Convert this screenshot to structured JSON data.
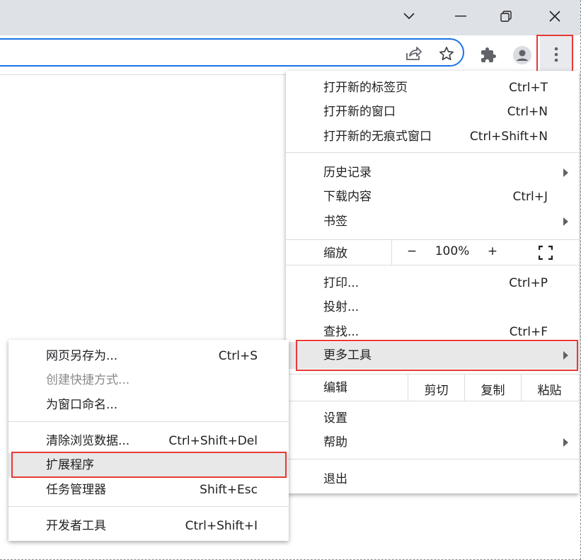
{
  "window_controls": {
    "tab_search_icon": "chevron-down-icon",
    "minimize_icon": "minimize-icon",
    "restore_icon": "restore-icon",
    "close_icon": "close-icon"
  },
  "toolbar": {
    "share_icon": "share-icon",
    "bookmark_icon": "star-icon",
    "extensions_icon": "puzzle-icon",
    "profile_icon": "avatar-icon",
    "menu_icon": "three-dots-vertical-icon"
  },
  "main_menu": {
    "new_tab": {
      "label": "打开新的标签页",
      "shortcut": "Ctrl+T"
    },
    "new_window": {
      "label": "打开新的窗口",
      "shortcut": "Ctrl+N"
    },
    "new_incognito": {
      "label": "打开新的无痕式窗口",
      "shortcut": "Ctrl+Shift+N"
    },
    "history": {
      "label": "历史记录"
    },
    "downloads": {
      "label": "下载内容",
      "shortcut": "Ctrl+J"
    },
    "bookmarks": {
      "label": "书签"
    },
    "zoom": {
      "label": "缩放",
      "minus": "−",
      "value": "100%",
      "plus": "+"
    },
    "print": {
      "label": "打印...",
      "shortcut": "Ctrl+P"
    },
    "cast": {
      "label": "投射..."
    },
    "find": {
      "label": "查找...",
      "shortcut": "Ctrl+F"
    },
    "more_tools": {
      "label": "更多工具"
    },
    "edit": {
      "label": "编辑",
      "cut": "剪切",
      "copy": "复制",
      "paste": "粘贴"
    },
    "settings": {
      "label": "设置"
    },
    "help": {
      "label": "帮助"
    },
    "exit": {
      "label": "退出"
    }
  },
  "sub_menu": {
    "save_page": {
      "label": "网页另存为...",
      "shortcut": "Ctrl+S"
    },
    "create_shortcut": {
      "label": "创建快捷方式..."
    },
    "name_window": {
      "label": "为窗口命名..."
    },
    "clear_data": {
      "label": "清除浏览数据...",
      "shortcut": "Ctrl+Shift+Del"
    },
    "extensions": {
      "label": "扩展程序"
    },
    "task_manager": {
      "label": "任务管理器",
      "shortcut": "Shift+Esc"
    },
    "dev_tools": {
      "label": "开发者工具",
      "shortcut": "Ctrl+Shift+I"
    }
  },
  "colors": {
    "highlight_border": "#e53935",
    "omnibox_focus": "#1a73e8",
    "hover_bg": "#e8e8e8"
  }
}
